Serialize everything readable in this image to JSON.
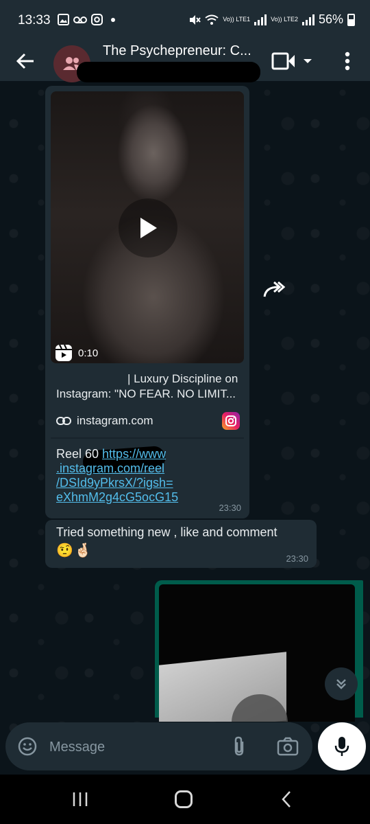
{
  "status_bar": {
    "time": "13:33",
    "volte1": "Vo)) LTE1",
    "volte2": "Vo)) LTE2",
    "battery": "56%"
  },
  "header": {
    "title": "The Psychepreneur: C..."
  },
  "messages": {
    "reel_post": {
      "duration": "0:10",
      "link_title_line1": "| Luxury Discipline on",
      "link_title_line2": "Instagram: \"NO FEAR. NO LIMIT...",
      "domain": "instagram.com",
      "text_prefix": "Reel 60 ",
      "url_line1": "https://www",
      "url_line2": ".instagram.com/reel",
      "url_line3": "/DSId9yPkrsX/?igsh=",
      "url_line4": "eXhmM2g4cG5ocG15",
      "time": "23:30"
    },
    "caption": {
      "text": "Tried something new , like and comment",
      "emoji1": "🤨",
      "emoji2": "🤞🏻",
      "time": "23:30"
    }
  },
  "composer": {
    "placeholder": "Message"
  },
  "colors": {
    "background": "#0b141a",
    "bubble_in": "#1f2c34",
    "bubble_out": "#005c4b",
    "link": "#53bdeb",
    "timestamp": "#8696a0"
  }
}
